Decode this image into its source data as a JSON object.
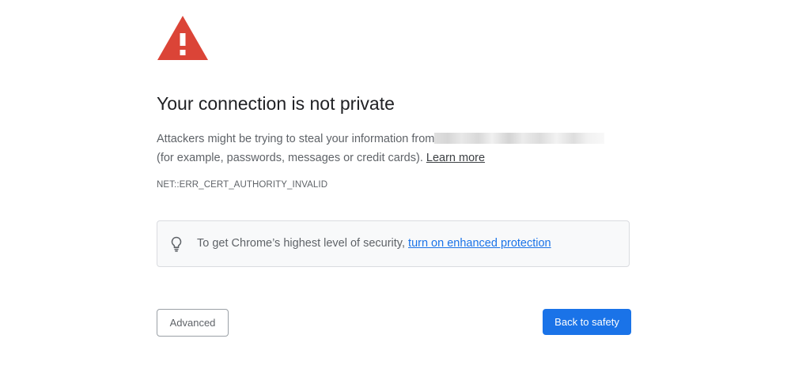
{
  "page": {
    "title": "Your connection is not private",
    "description_prefix": "Attackers might be trying to steal your information from",
    "description_suffix": "(for example, passwords, messages or credit cards).",
    "learn_more_label": "Learn more",
    "error_code": "NET::ERR_CERT_AUTHORITY_INVALID"
  },
  "promo": {
    "icon": "lightbulb-icon",
    "text": "To get Chrome’s highest level of security,",
    "link_label": "turn on enhanced protection"
  },
  "buttons": {
    "advanced_label": "Advanced",
    "back_label": "Back to safety"
  },
  "icons": {
    "warning": "warning-triangle-icon"
  },
  "colors": {
    "warning_red": "#db4437",
    "primary_blue": "#1a73e8",
    "text_gray": "#5f6368"
  }
}
